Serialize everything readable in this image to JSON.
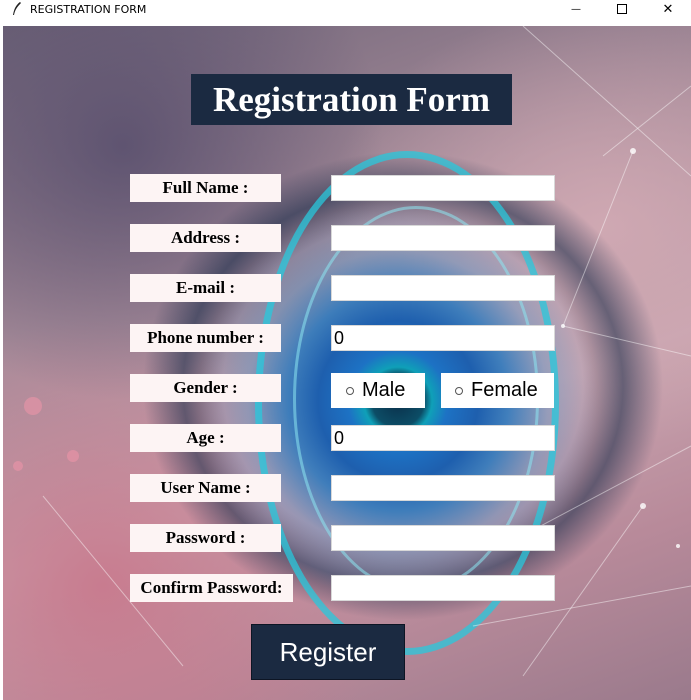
{
  "window": {
    "title": "REGISTRATION FORM",
    "minimize_glyph": "—",
    "maximize_icon": "square-icon",
    "close_glyph": "✕"
  },
  "form": {
    "title": "Registration Form",
    "fields": [
      {
        "label": "Full Name :",
        "value": ""
      },
      {
        "label": "Address :",
        "value": ""
      },
      {
        "label": "E-mail :",
        "value": ""
      },
      {
        "label": "Phone number :",
        "value": "0"
      },
      {
        "label": "Gender :"
      },
      {
        "label": "Age :",
        "value": "0"
      },
      {
        "label": "User Name :",
        "value": ""
      },
      {
        "label": "Password :",
        "value": ""
      },
      {
        "label": "Confirm Password:",
        "value": ""
      }
    ],
    "gender_options": [
      "Male",
      "Female"
    ],
    "gender_selected": "",
    "register_label": "Register"
  },
  "colors": {
    "title_bg": "#1b2a41",
    "label_bg": "#fdf4f4",
    "button_bg": "#1b2a41"
  }
}
